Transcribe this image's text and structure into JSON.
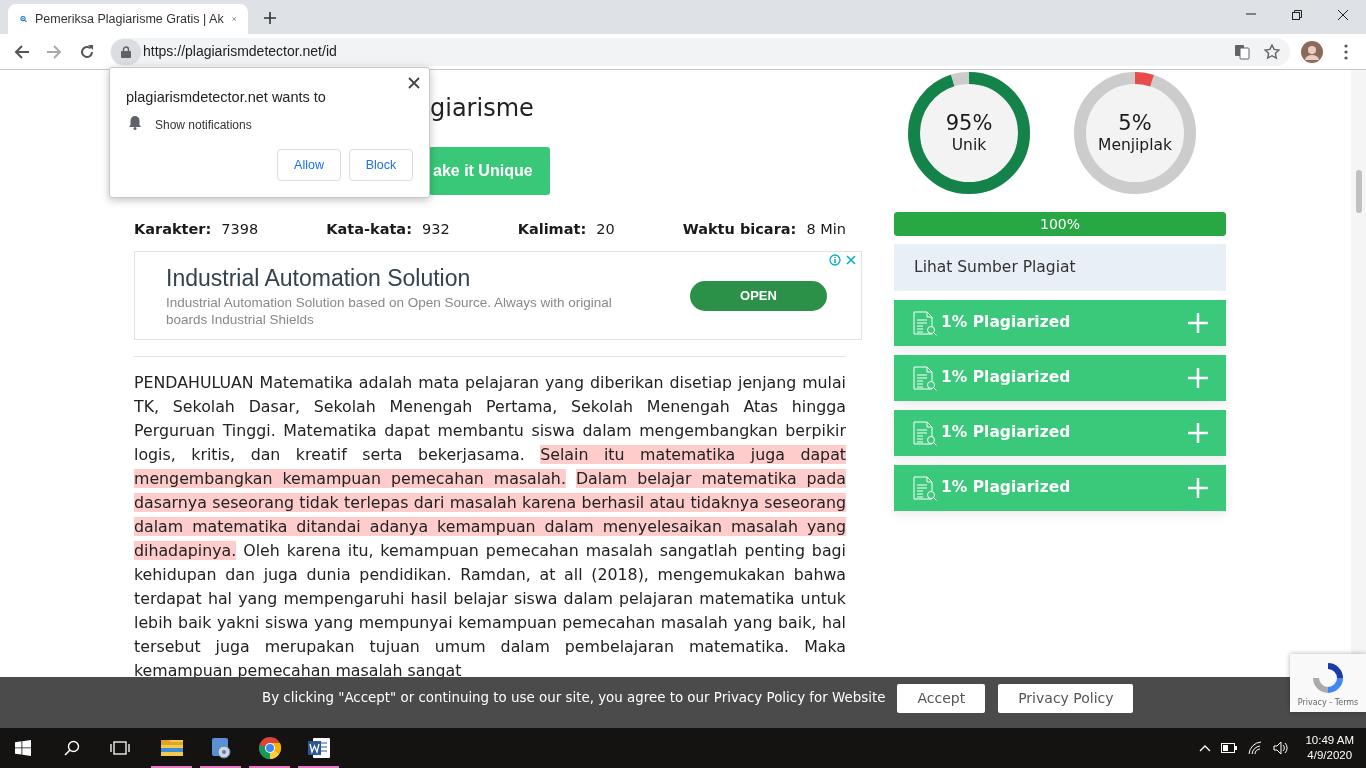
{
  "browser": {
    "tab": {
      "title": "Pemeriksa Plagiarisme Gratis | Ak"
    },
    "url": "https://plagiarismdetector.net/id"
  },
  "permission_popup": {
    "title": "plagiarismdetector.net wants to",
    "permission": "Show notifications",
    "buttons": [
      "Allow",
      "Block"
    ]
  },
  "page": {
    "heading": "giarisme",
    "action_button": "ake it Unique",
    "stats": [
      {
        "label": "Karakter:",
        "value": "7398"
      },
      {
        "label": "Kata-kata:",
        "value": "932"
      },
      {
        "label": "Kalimat:",
        "value": "20"
      },
      {
        "label": "Waktu bicara:",
        "value": "8 Min"
      }
    ],
    "ad": {
      "title": "Industrial Automation Solution",
      "description": "Industrial Automation Solution based on Open Source. Always with original boards Industrial Shields",
      "button": "OPEN"
    },
    "paragraph": [
      {
        "text": "PENDAHULUAN Matematika adalah mata pelajaran yang diberikan disetiap jenjang mulai TK, Sekolah Dasar, Sekolah Menengah Pertama, Sekolah Menengah Atas hingga Perguruan Tinggi. Matematika dapat membantu siswa dalam mengembangkan berpikir logis, kritis, dan kreatif serta bekerjasama.",
        "highlighted": false
      },
      {
        "text": "Selain itu matematika juga dapat mengembangkan kemampuan pemecahan masalah.",
        "highlighted": true
      },
      {
        "text": "Dalam belajar matematika pada dasarnya seseorang tidak terlepas dari masalah karena berhasil atau tidaknya seseorang dalam matematika ditandai adanya kemampuan dalam menyelesaikan masalah yang dihadapinya.",
        "highlighted": true
      },
      {
        "text": "Oleh karena itu, kemampuan pemecahan masalah sangatlah penting bagi kehidupan dan juga dunia pendidikan. Ramdan, at all (2018), mengemukakan bahwa terdapat hal yang mempengaruhi hasil belajar siswa dalam pelajaran matematika untuk lebih baik yakni siswa yang mempunyai kemampuan pemecahan masalah yang baik, hal tersebut juga merupakan tujuan umum dalam pembelajaran matematika. Maka kemampuan pemecahan masalah sangat",
        "highlighted": false
      }
    ]
  },
  "results": {
    "meters": [
      {
        "percent": "95%",
        "label": "Unik",
        "level": 0.95,
        "color": "#13834a"
      },
      {
        "percent": "5%",
        "label": "Menjiplak",
        "level": 0.05,
        "color": "#e94b4b"
      }
    ],
    "progress": {
      "label": "100%",
      "level": 1
    },
    "sources_title": "Lihat Sumber Plagiat",
    "sources": [
      {
        "label": "1% Plagiarized",
        "expanded": false
      },
      {
        "label": "1% Plagiarized",
        "expanded": false
      },
      {
        "label": "1% Plagiarized",
        "expanded": false
      },
      {
        "label": "1% Plagiarized",
        "expanded": false
      }
    ]
  },
  "cookie_bar": {
    "message": "By clicking \"Accept\" or continuing to use our site, you agree to our Privacy Policy for Website",
    "buttons": [
      "Accept",
      "Privacy Policy"
    ]
  },
  "recaptcha": {
    "links": "Privacy - Terms"
  },
  "taskbar": {
    "apps": [
      {
        "kind": "explorer",
        "running": true
      },
      {
        "kind": "media",
        "running": true
      },
      {
        "kind": "chrome",
        "running": true
      },
      {
        "kind": "word",
        "running": true
      }
    ],
    "time": "10:49 AM",
    "date": "4/9/2020"
  }
}
